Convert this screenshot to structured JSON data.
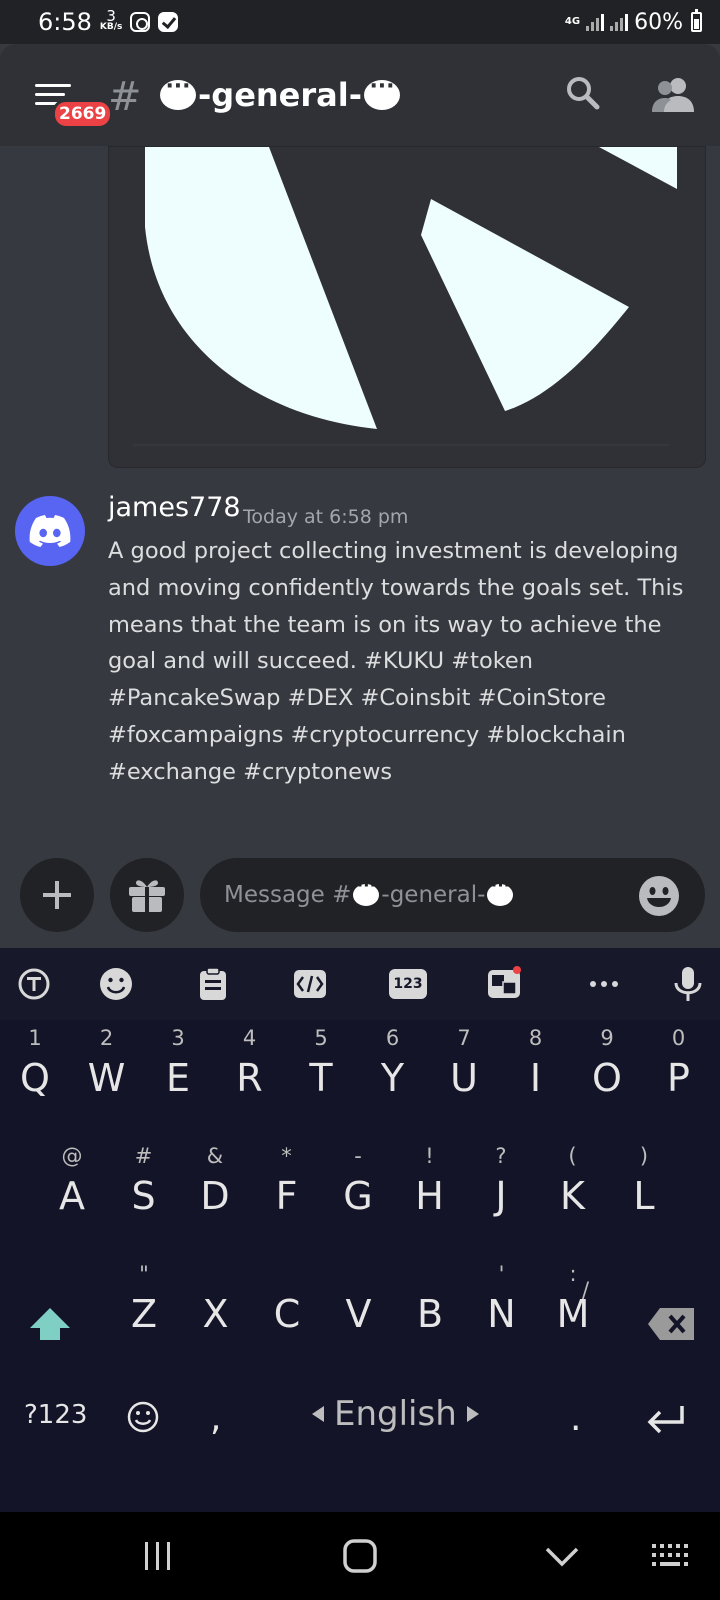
{
  "status_bar": {
    "time": "6:58",
    "net_speed_value": "3",
    "net_speed_unit": "KB/s",
    "network_type": "4G",
    "battery": "60%"
  },
  "header": {
    "badge": "2669",
    "hash": "#",
    "channel_name": "-general-"
  },
  "message": {
    "author": "james778",
    "timestamp": "Today at 6:58 pm",
    "text": "A good project collecting investment is developing and moving confidently towards the goals set. This means that the team is on its way to achieve the goal and will succeed. #KUKU #token #PancakeSwap #DEX #Coinsbit #CoinStore #foxcampaigns #cryptocurrency #blockchain #exchange #cryptonews"
  },
  "composer": {
    "placeholder_prefix": "Message #",
    "placeholder_channel": "-general-"
  },
  "keyboard": {
    "toolbar": {
      "numbers_label": "123"
    },
    "row1": [
      {
        "key": "Q",
        "hint": "1"
      },
      {
        "key": "W",
        "hint": "2"
      },
      {
        "key": "E",
        "hint": "3"
      },
      {
        "key": "R",
        "hint": "4"
      },
      {
        "key": "T",
        "hint": "5"
      },
      {
        "key": "Y",
        "hint": "6"
      },
      {
        "key": "U",
        "hint": "7"
      },
      {
        "key": "I",
        "hint": "8"
      },
      {
        "key": "O",
        "hint": "9"
      },
      {
        "key": "P",
        "hint": "0"
      }
    ],
    "row2": [
      {
        "key": "A",
        "hint": "@"
      },
      {
        "key": "S",
        "hint": "#"
      },
      {
        "key": "D",
        "hint": "&"
      },
      {
        "key": "F",
        "hint": "*"
      },
      {
        "key": "G",
        "hint": "-"
      },
      {
        "key": "H",
        "hint": "!"
      },
      {
        "key": "J",
        "hint": "?"
      },
      {
        "key": "K",
        "hint": "("
      },
      {
        "key": "L",
        "hint": ")"
      }
    ],
    "row3": [
      {
        "key": "Z",
        "hint": "\""
      },
      {
        "key": "X",
        "hint": ""
      },
      {
        "key": "C",
        "hint": ""
      },
      {
        "key": "V",
        "hint": ""
      },
      {
        "key": "B",
        "hint": ""
      },
      {
        "key": "N",
        "hint": "'"
      },
      {
        "key": "M",
        "hint": ":"
      }
    ],
    "row3_extra_hint": "/",
    "symbols_key": "?123",
    "comma": ",",
    "language": "English",
    "period": "."
  },
  "colors": {
    "background": "#36393f",
    "header": "#2f3136",
    "input": "#202225",
    "blurple": "#5865f2",
    "badge": "#ed4245",
    "keyboard": "#131427",
    "shift_accent": "#7fcfc4"
  }
}
